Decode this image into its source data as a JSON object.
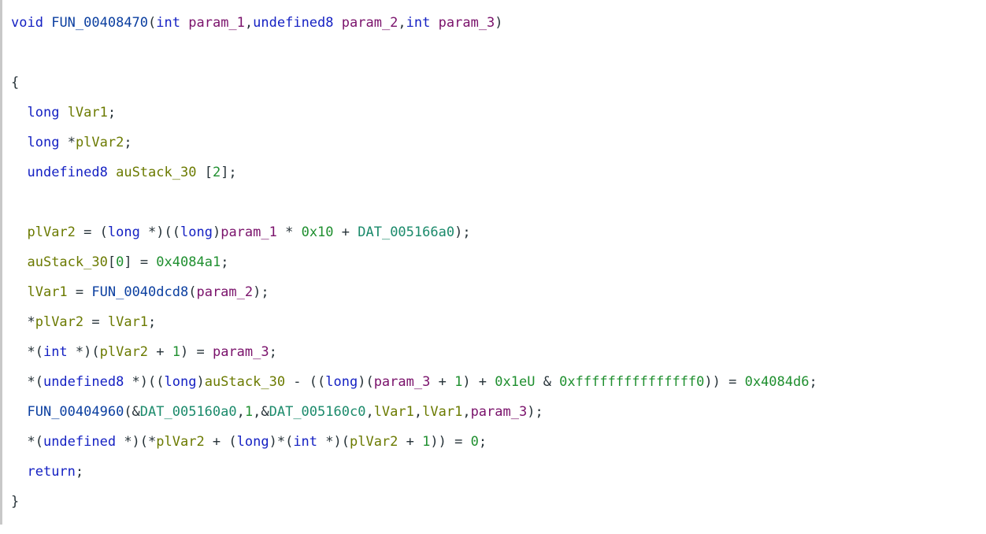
{
  "code": {
    "line1": {
      "kw_void": "void",
      "func": "FUN_00408470",
      "lp": "(",
      "t_int1": "int",
      "p1": "param_1",
      "c1": ",",
      "t_u8": "undefined8",
      "p2": "param_2",
      "c2": ",",
      "t_int2": "int",
      "p3": "param_3",
      "rp": ")"
    },
    "line3": {
      "brace": "{"
    },
    "line4": {
      "indent": "  ",
      "t_long": "long",
      "id": "lVar1",
      "semi": ";"
    },
    "line5": {
      "indent": "  ",
      "t_long": "long",
      "star": "*",
      "id": "plVar2",
      "semi": ";"
    },
    "line6": {
      "indent": "  ",
      "t_u8": "undefined8",
      "id": "auStack_30",
      "arr": " [",
      "n": "2",
      "arr2": "];"
    },
    "line8": {
      "indent": "  ",
      "id": "plVar2",
      "eq": " = (",
      "t_long": "long",
      "star": " *)((",
      "t_long2": "long",
      "rp": ")",
      "p1": "param_1",
      "mul": " * ",
      "hex": "0x10",
      "plus": " + ",
      "glob": "DAT_005166a0",
      "end": ");"
    },
    "line9": {
      "indent": "  ",
      "id": "auStack_30",
      "br": "[",
      "idx": "0",
      "br2": "] = ",
      "hex": "0x4084a1",
      "semi": ";"
    },
    "line10": {
      "indent": "  ",
      "id": "lVar1",
      "eq": " = ",
      "func": "FUN_0040dcd8",
      "lp": "(",
      "p2": "param_2",
      "rp": ");"
    },
    "line11": {
      "indent": "  *",
      "id": "plVar2",
      "eq": " = ",
      "id2": "lVar1",
      "semi": ";"
    },
    "line12": {
      "indent": "  *(",
      "t_int": "int",
      "mid": " *)(",
      "id": "plVar2",
      "plus": " + ",
      "one": "1",
      "rp": ") = ",
      "p3": "param_3",
      "semi": ";"
    },
    "line13": {
      "indent": "  *(",
      "t_u8": "undefined8",
      "mid": " *)((",
      "t_long": "long",
      "rp1": ")",
      "id": "auStack_30",
      "minus": " - ((",
      "t_long2": "long",
      "rp2": ")(",
      "p3": "param_3",
      "plus": " + ",
      "one": "1",
      "rp3": ") + ",
      "hex1": "0x1eU",
      "amp": " & ",
      "hex2": "0xfffffffffffffff0",
      "rp4": ")) = ",
      "hex3": "0x4084d6",
      "semi": ";"
    },
    "line14": {
      "indent": "  ",
      "func": "FUN_00404960",
      "lp": "(&",
      "g1": "DAT_005160a0",
      "c1": ",",
      "one": "1",
      "c2": ",&",
      "g2": "DAT_005160c0",
      "c3": ",",
      "id1": "lVar1",
      "c4": ",",
      "id2": "lVar1",
      "c5": ",",
      "p3": "param_3",
      "rp": ");"
    },
    "line15": {
      "indent": "  *(",
      "t_und": "undefined",
      "mid": " *)(*",
      "id": "plVar2",
      "plus": " + (",
      "t_long": "long",
      "rp1": ")*(",
      "t_int": "int",
      "rp2": " *)(",
      "id2": "plVar2",
      "plus2": " + ",
      "one": "1",
      "rp3": ")) = ",
      "zero": "0",
      "semi": ";"
    },
    "line16": {
      "indent": "  ",
      "kw": "return",
      "semi": ";"
    },
    "line17": {
      "brace": "}"
    }
  }
}
